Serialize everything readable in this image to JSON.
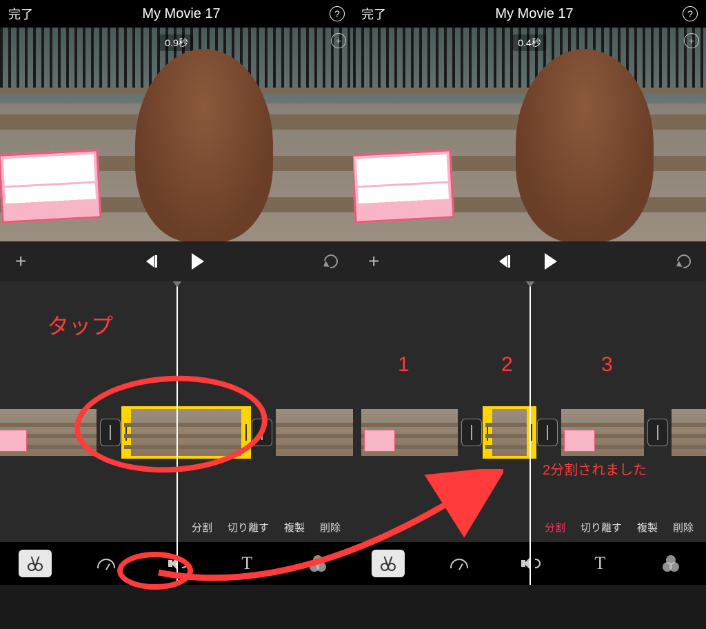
{
  "left": {
    "done_label": "完了",
    "title": "My Movie 17",
    "help": "?",
    "time": "0.9秒",
    "tap_label": "タップ",
    "edit_actions": [
      "分割",
      "切り離す",
      "複製",
      "削除"
    ]
  },
  "right": {
    "done_label": "完了",
    "title": "My Movie 17",
    "help": "?",
    "time": "0.4秒",
    "numbers": [
      "1",
      "2",
      "3"
    ],
    "split_msg": "2分割されました",
    "edit_actions": [
      "分割",
      "切り離す",
      "複製",
      "削除"
    ]
  }
}
